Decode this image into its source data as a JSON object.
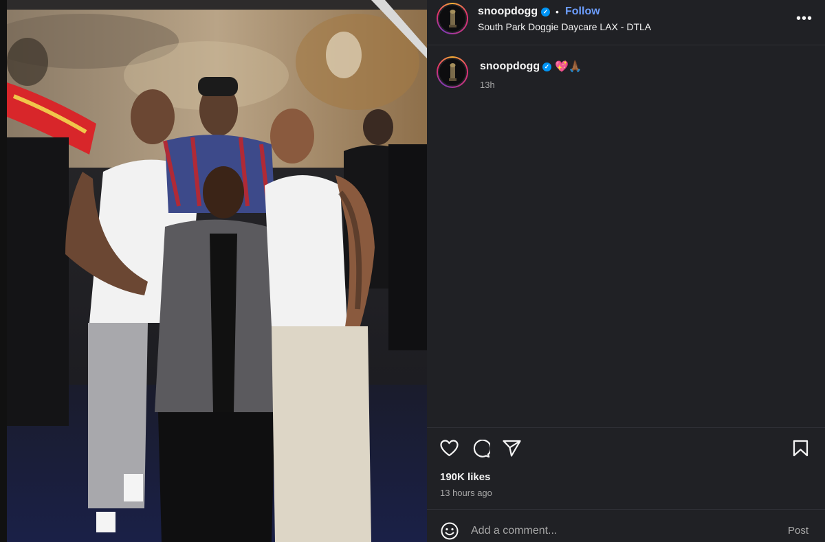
{
  "post": {
    "username": "snoopdogg",
    "verified_mark": "✓",
    "separator": "•",
    "follow_label": "Follow",
    "location": "South Park Doggie Daycare LAX - DTLA",
    "more_label": "•••",
    "caption": {
      "username": "snoopdogg",
      "emojis": "💖🙏🏾",
      "time": "13h"
    },
    "likes": "190K likes",
    "posted_ago": "13 hours ago",
    "comment": {
      "placeholder": "Add a comment...",
      "post_label": "Post"
    }
  },
  "icons": {
    "like": "heart-icon",
    "comment": "comment-bubble-icon",
    "share": "paper-plane-icon",
    "save": "bookmark-icon",
    "emoji": "smiley-icon",
    "more": "ellipsis-icon"
  },
  "colors": {
    "panel_bg": "#202125",
    "follow": "#6d9eff",
    "verified": "#0095f6",
    "muted": "#a8a8a8"
  }
}
